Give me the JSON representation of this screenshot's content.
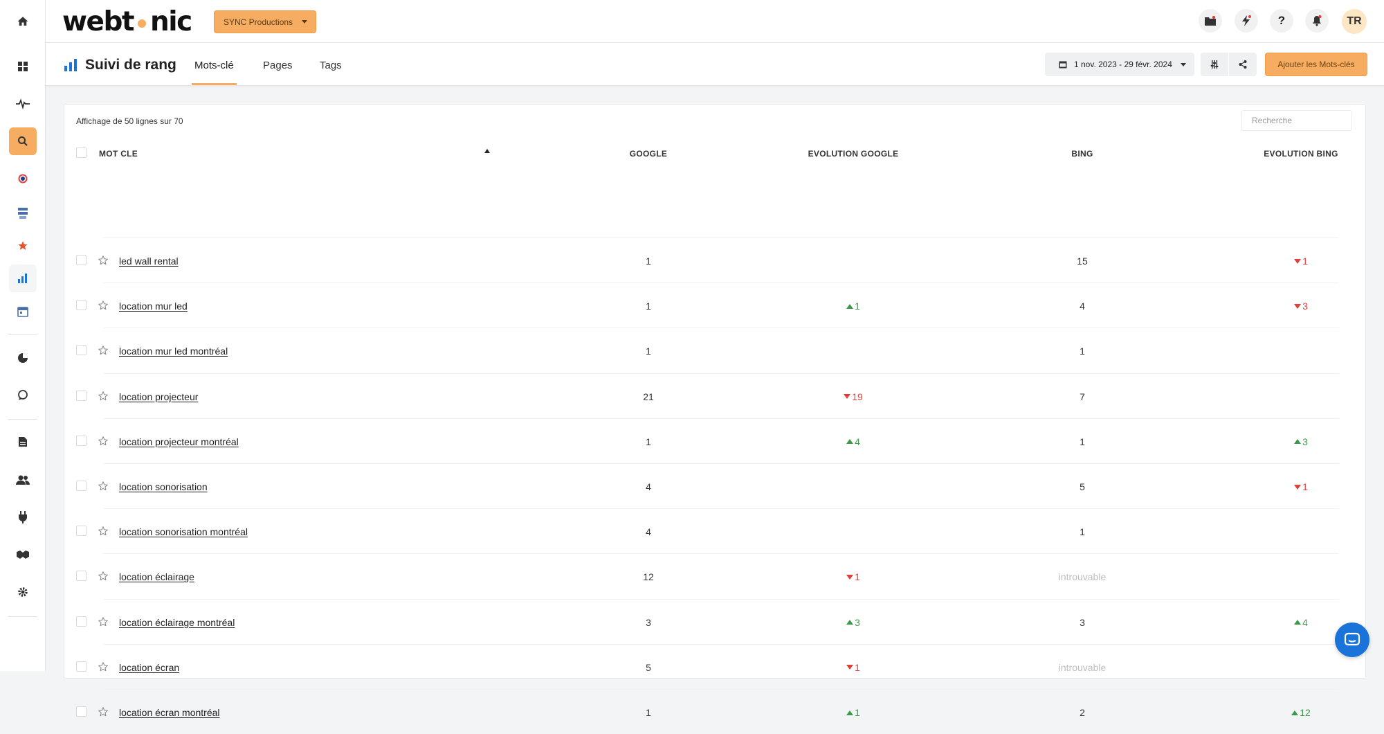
{
  "app": {
    "logo_text": "webt",
    "logo_text_end": "nic"
  },
  "colors": {
    "accent": "#f6ad62",
    "up": "#3a9a47",
    "down": "#e0403a",
    "chart_blue": "#1a73d9"
  },
  "topbar": {
    "project_selector": "SYNC Productions",
    "avatar_initials": "TR"
  },
  "subheader": {
    "title": "Suivi de rang",
    "tabs": [
      {
        "label": "Mots-clé",
        "active": true
      },
      {
        "label": "Pages"
      },
      {
        "label": "Tags"
      }
    ],
    "date_range": "1 nov. 2023 - 29 févr. 2024",
    "add_button": "Ajouter les Mots-clés"
  },
  "table": {
    "showing": "Affichage de 50 lignes sur 70",
    "search_placeholder": "Recherche",
    "headers": {
      "keyword": "MOT CLE",
      "google": "GOOGLE",
      "evolution_google": "EVOLUTION GOOGLE",
      "bing": "BING",
      "evolution_bing": "EVOLUTION BING"
    },
    "rows": [
      {
        "keyword": "led wall rental",
        "google": "1",
        "evo_google": "",
        "evo_google_dir": "",
        "bing": "15",
        "evo_bing": "1",
        "evo_bing_dir": "down"
      },
      {
        "keyword": "location mur led",
        "google": "1",
        "evo_google": "1",
        "evo_google_dir": "up",
        "bing": "4",
        "evo_bing": "3",
        "evo_bing_dir": "down"
      },
      {
        "keyword": "location mur led montréal",
        "google": "1",
        "evo_google": "",
        "evo_google_dir": "",
        "bing": "1",
        "evo_bing": "",
        "evo_bing_dir": ""
      },
      {
        "keyword": "location projecteur",
        "google": "21",
        "evo_google": "19",
        "evo_google_dir": "down",
        "bing": "7",
        "evo_bing": "",
        "evo_bing_dir": ""
      },
      {
        "keyword": "location projecteur montréal",
        "google": "1",
        "evo_google": "4",
        "evo_google_dir": "up",
        "bing": "1",
        "evo_bing": "3",
        "evo_bing_dir": "up"
      },
      {
        "keyword": "location sonorisation",
        "google": "4",
        "evo_google": "",
        "evo_google_dir": "",
        "bing": "5",
        "evo_bing": "1",
        "evo_bing_dir": "down"
      },
      {
        "keyword": "location sonorisation montréal",
        "google": "4",
        "evo_google": "",
        "evo_google_dir": "",
        "bing": "1",
        "evo_bing": "",
        "evo_bing_dir": ""
      },
      {
        "keyword": "location éclairage",
        "google": "12",
        "evo_google": "1",
        "evo_google_dir": "down",
        "bing": "introuvable",
        "evo_bing": "",
        "evo_bing_dir": ""
      },
      {
        "keyword": "location éclairage montréal",
        "google": "3",
        "evo_google": "3",
        "evo_google_dir": "up",
        "bing": "3",
        "evo_bing": "4",
        "evo_bing_dir": "up"
      },
      {
        "keyword": "location écran",
        "google": "5",
        "evo_google": "1",
        "evo_google_dir": "down",
        "bing": "introuvable",
        "evo_bing": "",
        "evo_bing_dir": ""
      },
      {
        "keyword": "location écran montréal",
        "google": "1",
        "evo_google": "1",
        "evo_google_dir": "up",
        "bing": "2",
        "evo_bing": "12",
        "evo_bing_dir": "up"
      }
    ]
  }
}
